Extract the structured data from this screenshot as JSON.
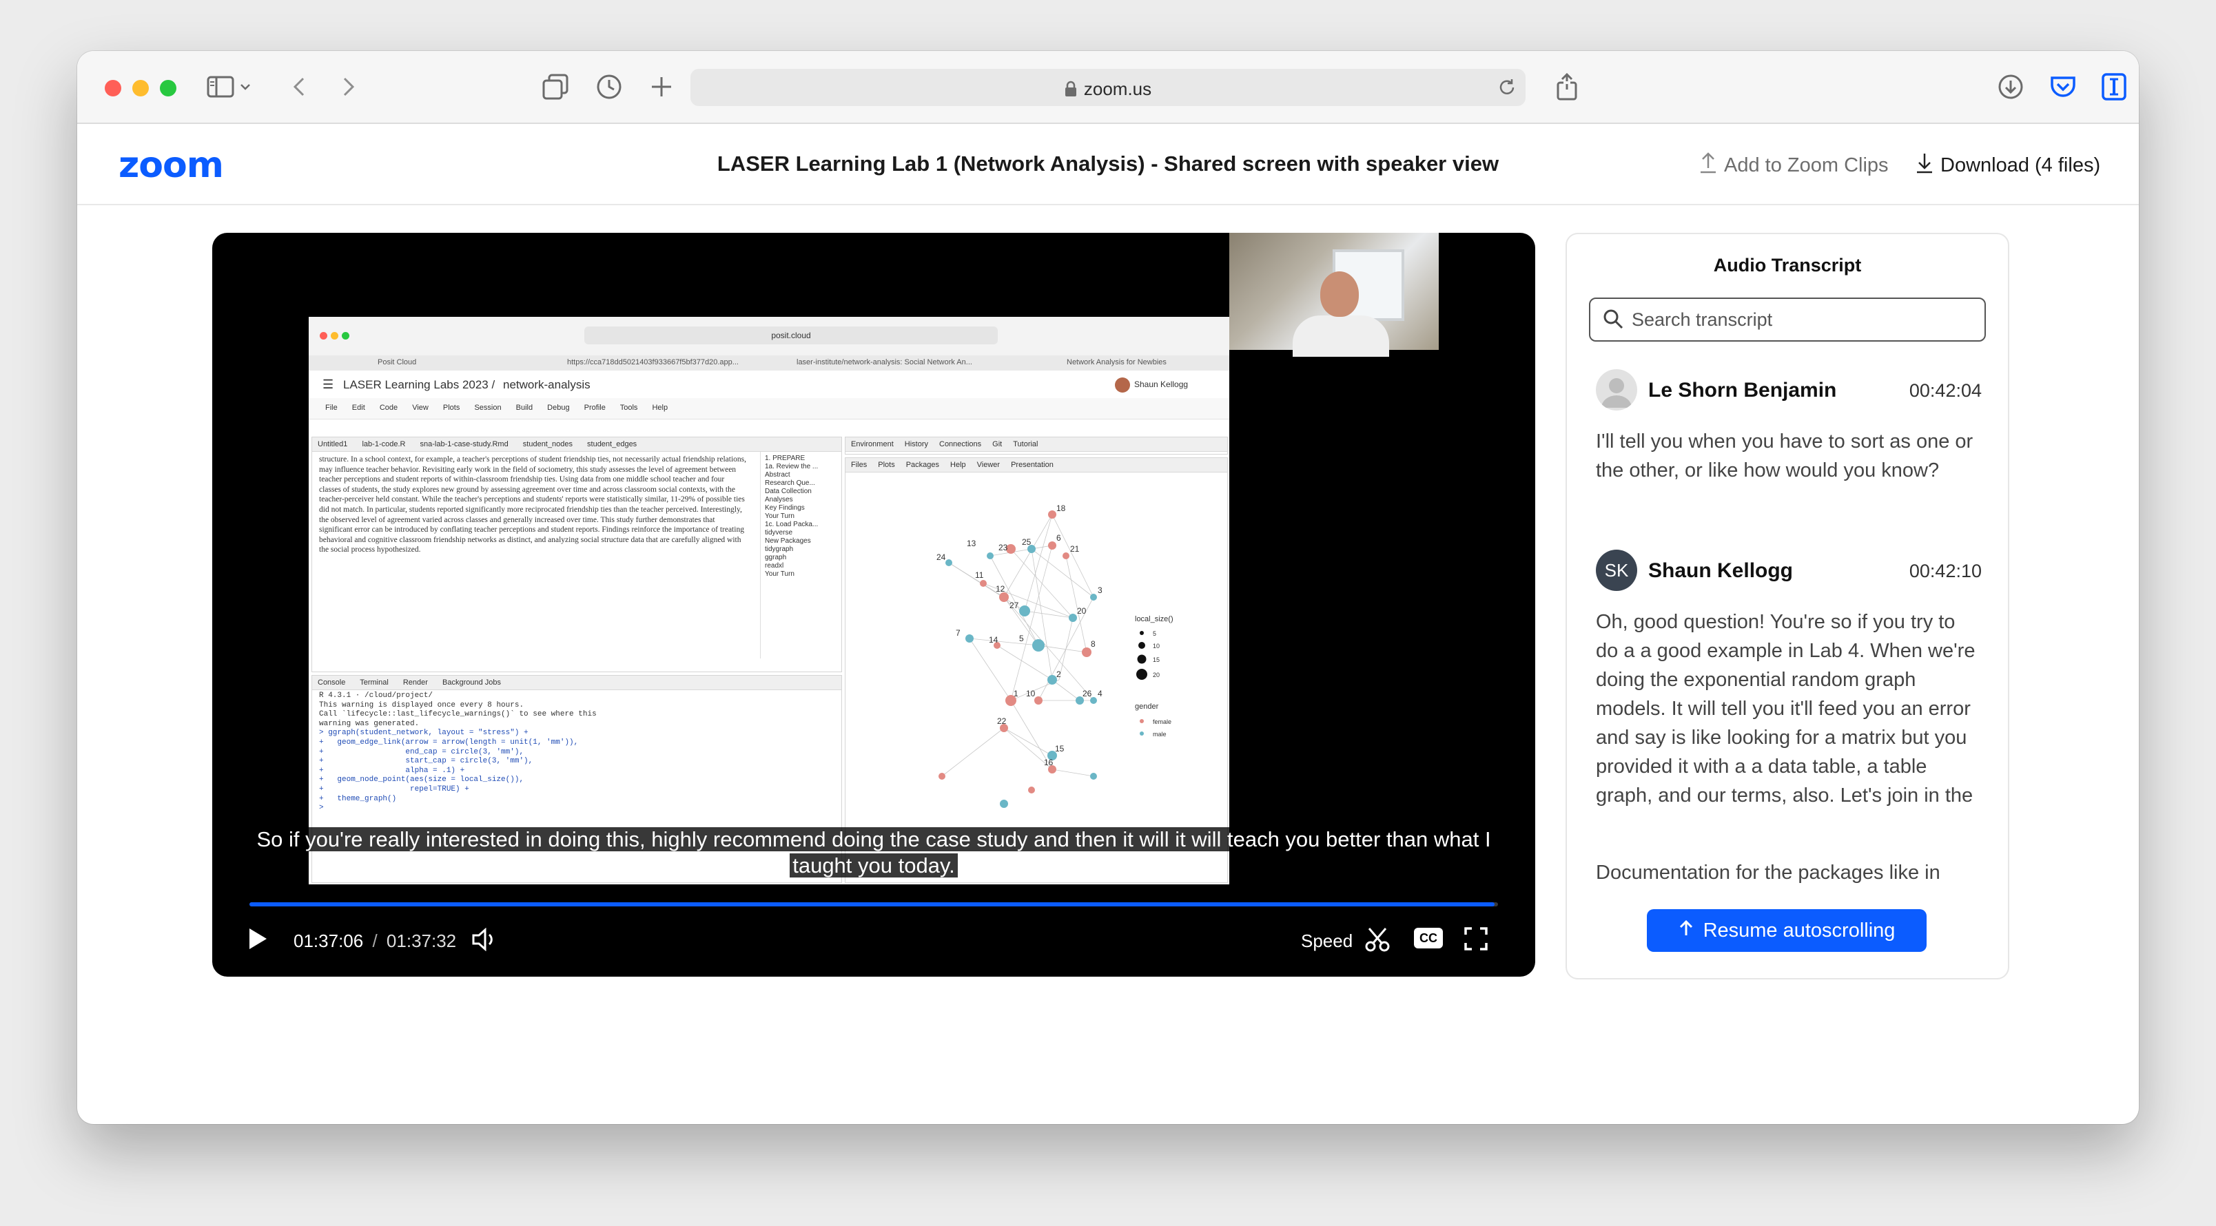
{
  "browser": {
    "url": "zoom.us",
    "colors": {
      "close": "#ff5f57",
      "minimize": "#febc2e",
      "maximize": "#28c840"
    },
    "icons": [
      "sidebar-icon",
      "chevron-down-icon",
      "back-icon",
      "forward-icon",
      "tabs-overview-icon",
      "history-icon",
      "new-tab-icon",
      "lock-icon",
      "reload-icon",
      "share-icon",
      "downloads-icon",
      "pocket-icon",
      "reader-icon"
    ]
  },
  "header": {
    "logo": "zoom",
    "title": "LASER Learning Lab 1 (Network Analysis) - Shared screen with speaker view",
    "add_clips": "Add to Zoom Clips",
    "download": "Download (4 files)",
    "accent": "#0b5cff"
  },
  "player": {
    "caption": "So if you're really interested in doing this, highly recommend doing the case study and then it will it will teach you better than what I taught you today.",
    "current_time": "01:37:06",
    "separator": "/",
    "duration": "01:37:32",
    "progress": 0.997,
    "speed_label": "Speed",
    "cc_label": "CC",
    "shared_screen": {
      "browser_url": "posit.cloud",
      "tabs": [
        "Posit Cloud",
        "https://cca718dd5021403f933667f5bf377d20.app...",
        "laser-institute/network-analysis: Social Network An...",
        "Network Analysis for Newbies"
      ],
      "project": "LASER Learning Labs 2023 /",
      "project_name": "network-analysis",
      "user": "Shaun Kellogg",
      "menu": [
        "File",
        "Edit",
        "Code",
        "View",
        "Plots",
        "Session",
        "Build",
        "Debug",
        "Profile",
        "Tools",
        "Help"
      ],
      "editor_tabs": [
        "Untitled1",
        "lab-1-code.R",
        "sna-lab-1-case-study.Rmd",
        "student_nodes",
        "student_edges"
      ],
      "editor_text": "structure. In a school context, for example, a teacher's perceptions of student friendship ties, not necessarily actual friendship relations, may influence teacher behavior. Revisiting early work in the field of sociometry, this study assesses the level of agreement between teacher perceptions and student reports of within-classroom friendship ties. Using data from one middle school teacher and four classes of students, the study explores new ground by assessing agreement over time and across classroom social contexts, with the teacher-perceiver held constant. While the teacher's perceptions and students' reports were statistically similar, 11-29% of possible ties did not match. In particular, students reported significantly more reciprocated friendship ties than the teacher perceived. Interestingly, the observed level of agreement varied across classes and generally increased over time. This study further demonstrates that significant error can be introduced by conflating teacher perceptions and student reports. Findings reinforce the importance of treating behavioral and cognitive classroom friendship networks as distinct, and analyzing social structure data that are carefully aligned with the social process hypothesized.",
      "outline": [
        "1. PREPARE",
        "1a. Review the ...",
        "Abstract",
        "Research Que...",
        "Data Collection",
        "Analyses",
        "Key Findings",
        "Your Turn",
        "1c. Load Packa...",
        "tidyverse",
        "New Packages",
        "tidygraph",
        "ggraph",
        "readxl",
        "Your Turn"
      ],
      "console_tabs": [
        "Console",
        "Terminal",
        "Render",
        "Background Jobs"
      ],
      "console_lines": [
        "R 4.3.1 · /cloud/project/",
        "This warning is displayed once every 8 hours.",
        "Call `lifecycle::last_lifecycle_warnings()` to see where this",
        "warning was generated.",
        "> ggraph(student_network, layout = \"stress\") +",
        "+   geom_edge_link(arrow = arrow(length = unit(1, 'mm')),",
        "+                  end_cap = circle(3, 'mm'),",
        "+                  start_cap = circle(3, 'mm'),",
        "+                  alpha = .1) +",
        "+   geom_node_point(aes(size = local_size()),",
        "+                   repel=TRUE) +",
        "+   theme_graph()",
        ">"
      ],
      "env_tabs": [
        "Environment",
        "History",
        "Connections",
        "Git",
        "Tutorial"
      ],
      "files_tabs": [
        "Files",
        "Plots",
        "Packages",
        "Help",
        "Viewer",
        "Presentation"
      ],
      "legend_title": "local_size()",
      "legend_sizes": [
        "5",
        "10",
        "15",
        "20"
      ],
      "gender_title": "gender",
      "gender_items": [
        "female",
        "male"
      ],
      "node_labels": [
        "18",
        "23",
        "13",
        "25",
        "6",
        "24",
        "11",
        "12",
        "27",
        "20",
        "3",
        "21",
        "5",
        "8",
        "7",
        "14",
        "2",
        "1",
        "10",
        "26",
        "4",
        "22",
        "15",
        "16"
      ]
    }
  },
  "transcript": {
    "title": "Audio Transcript",
    "search_placeholder": "Search transcript",
    "entries": [
      {
        "name": "Le Shorn Benjamin",
        "time": "00:42:04",
        "initials": "",
        "text": "I'll tell you when you have to sort as one or the other, or like how would you know?"
      },
      {
        "name": "Shaun Kellogg",
        "time": "00:42:10",
        "initials": "SK",
        "text": "Oh, good question! You're so if you try to do a a good example in Lab 4. When we're doing the exponential random graph models. It will tell you it'll feed you an error and say is like looking for a matrix but you provided it with a a data table, a table graph, and our terms, also. Let's join in the"
      }
    ],
    "trailing_text": "Documentation for the packages like in",
    "resume_label": "Resume autoscrolling"
  }
}
